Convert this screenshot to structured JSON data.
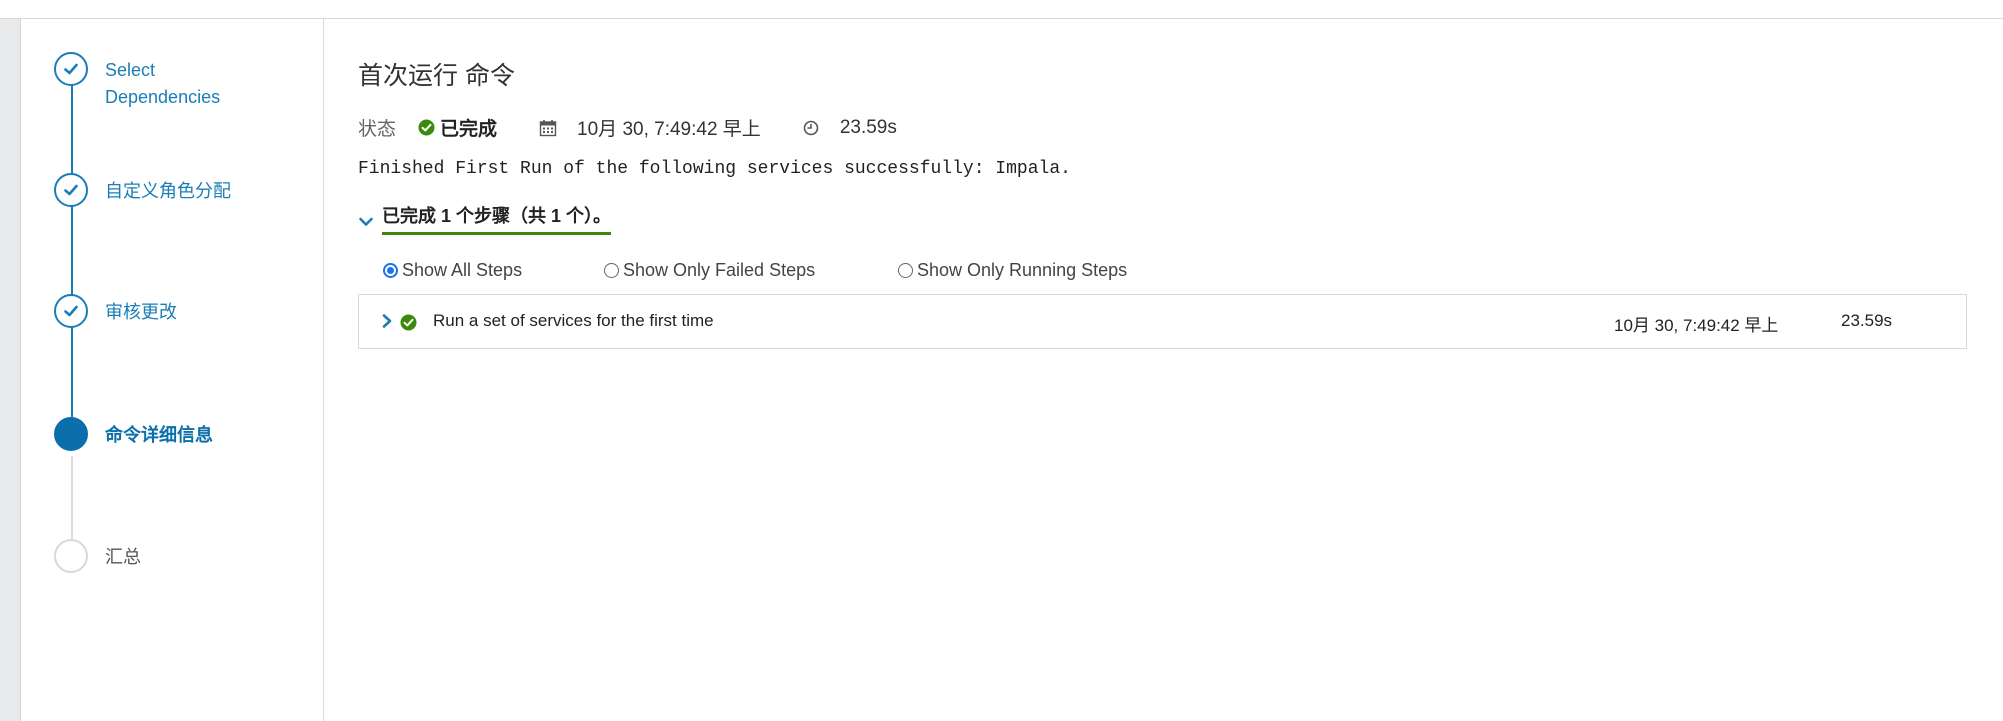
{
  "wizard": {
    "steps": [
      {
        "label": "Select Dependencies",
        "state": "done"
      },
      {
        "label": "自定义角色分配",
        "state": "done"
      },
      {
        "label": "审核更改",
        "state": "done"
      },
      {
        "label": "命令详细信息",
        "state": "active"
      },
      {
        "label": "汇总",
        "state": "pending"
      }
    ]
  },
  "command": {
    "title": "首次运行 命令",
    "status_label": "状态",
    "status_value": "已完成",
    "datetime": "10月 30, 7:49:42 早上",
    "duration": "23.59s",
    "message": "Finished First Run of the following services successfully: Impala.",
    "steps_summary": "已完成 1 个步骤（共 1 个）。"
  },
  "filters": {
    "options": [
      "Show All Steps",
      "Show Only Failed Steps",
      "Show Only Running Steps"
    ],
    "selected": "Show All Steps"
  },
  "step_rows": [
    {
      "name": "Run a set of services for the first time",
      "time": "10月 30, 7:49:42 早上",
      "duration": "23.59s",
      "status": "success"
    }
  ],
  "colors": {
    "accent": "#1b7db8",
    "active": "#0a6fab",
    "success": "#3b8a0c"
  }
}
